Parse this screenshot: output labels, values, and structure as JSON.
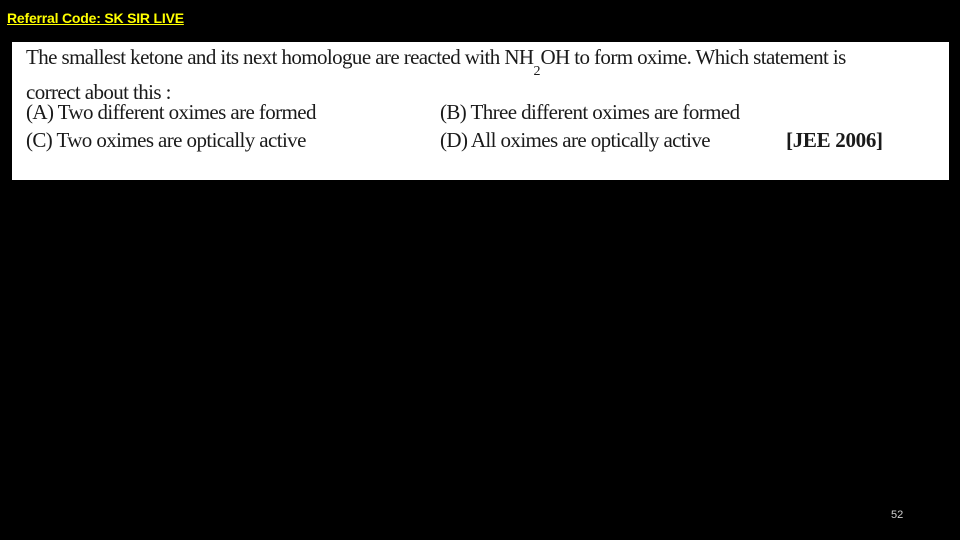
{
  "header": {
    "referral_label": "Referral Code: SK SIR LIVE"
  },
  "question": {
    "stem_line1_pre": "The smallest ketone and its next homologue are reacted with NH",
    "stem_subscript": "2",
    "stem_line1_post": "OH to form oxime. Which statement is",
    "stem_line2": "correct about this :",
    "options": [
      {
        "label": "(A) Two different oximes are formed"
      },
      {
        "label": "(B) Three different oximes are formed"
      },
      {
        "label": "(C) Two oximes are optically active"
      },
      {
        "label": "(D) All oximes are optically active"
      }
    ],
    "exam_tag": "[JEE 2006]"
  },
  "footer": {
    "page_number": "52"
  }
}
